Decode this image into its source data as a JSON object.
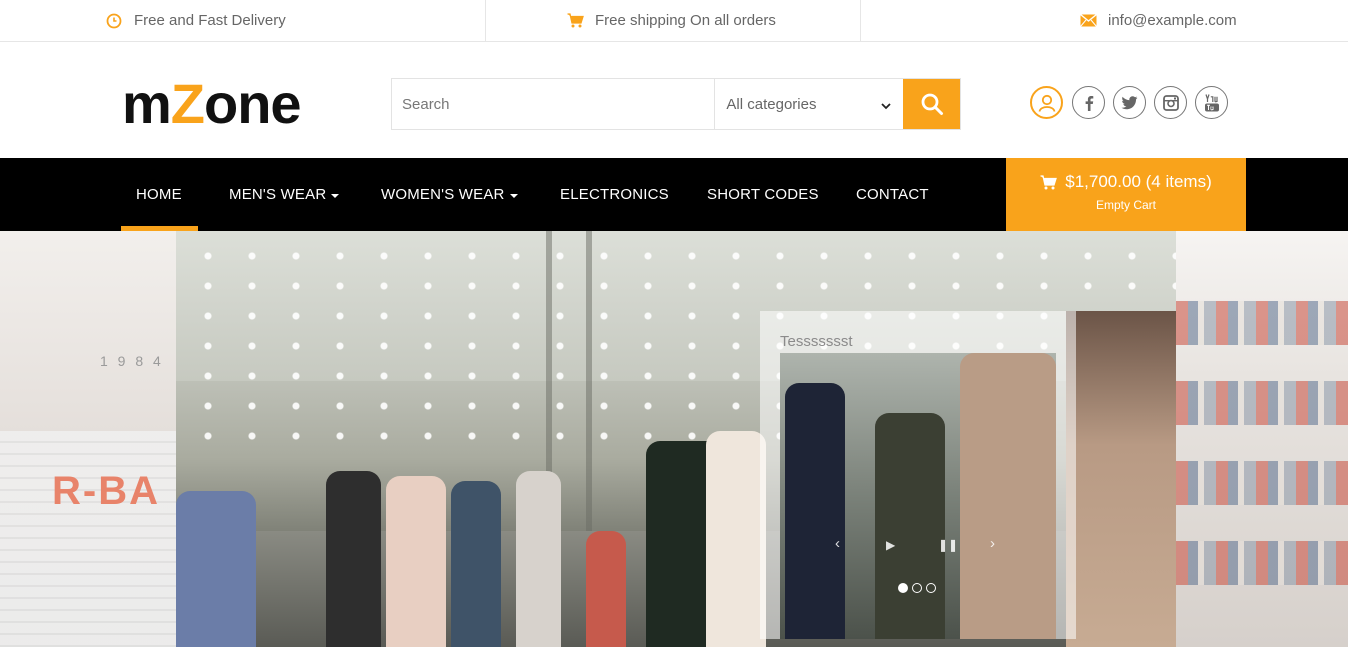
{
  "topbar": {
    "delivery_text": "Free and Fast Delivery",
    "delivery_icon": "clock-icon",
    "shipping_text": "Free shipping On all orders",
    "shipping_icon": "cart-icon",
    "email_text": "info@example.com",
    "email_icon": "envelope-icon",
    "icon_color": "#f9a31b"
  },
  "logo": {
    "part1": "m",
    "accent": "Z",
    "part2": "one",
    "accent_color": "#f9a31b"
  },
  "search": {
    "placeholder": "Search",
    "category_selected": "All categories",
    "button_icon": "search-icon",
    "button_color": "#f9a31b"
  },
  "social": [
    "user-icon",
    "facebook-icon",
    "twitter-icon",
    "instagram-icon",
    "youtube-icon"
  ],
  "nav": {
    "items": [
      {
        "label": "HOME",
        "dropdown": false,
        "active": true
      },
      {
        "label": "MEN'S WEAR",
        "dropdown": true
      },
      {
        "label": "WOMEN'S WEAR",
        "dropdown": true
      },
      {
        "label": "ELECTRONICS",
        "dropdown": false
      },
      {
        "label": "SHORT CODES",
        "dropdown": false
      },
      {
        "label": "CONTACT",
        "dropdown": false
      }
    ],
    "background": "#000000",
    "active_color": "#f9a31b"
  },
  "cart": {
    "summary": "$1,700.00 (4 items)",
    "empty_label": "Empty Cart",
    "icon": "cart-icon"
  },
  "slider": {
    "caption": "Tessssssst",
    "controls": [
      "chevron-left-icon",
      "play-icon",
      "pause-icon",
      "chevron-right-icon"
    ],
    "dots": 3,
    "active_dot": 1
  }
}
